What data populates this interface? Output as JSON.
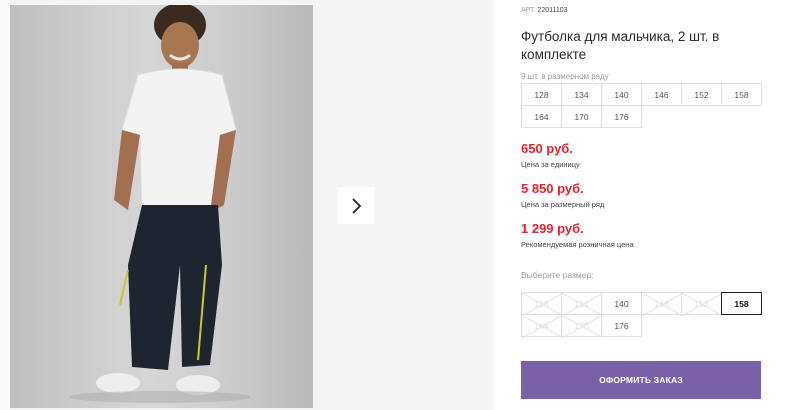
{
  "gallery": {
    "next_icon": "chevron-right-icon"
  },
  "product": {
    "article_prefix": "АРТ.",
    "article_number": "22011103",
    "title": "Футболка для мальчика, 2 шт. в комплекте",
    "row_count": "9 шт. в размерном ряду",
    "size_row": [
      [
        "128",
        "134",
        "140",
        "146",
        "152",
        "158"
      ],
      [
        "164",
        "170",
        "176"
      ]
    ],
    "prices": [
      {
        "value": "650 руб.",
        "label": "Цена за единицу"
      },
      {
        "value": "5 850 руб.",
        "label": "Цена за размерный ряд"
      },
      {
        "value": "1 299 руб.",
        "label": "Рекомендуемая розничная цена"
      }
    ],
    "choose_size_label": "Выберите размер:",
    "size_options": [
      [
        {
          "size": "128",
          "available": false
        },
        {
          "size": "134",
          "available": false
        },
        {
          "size": "140",
          "available": true
        },
        {
          "size": "146",
          "available": false
        },
        {
          "size": "152",
          "available": false
        },
        {
          "size": "158",
          "available": true,
          "selected": true
        }
      ],
      [
        {
          "size": "164",
          "available": false
        },
        {
          "size": "170",
          "available": false
        },
        {
          "size": "176",
          "available": true
        }
      ]
    ],
    "order_button": "ОФОРМИТЬ ЗАКАЗ"
  },
  "colors": {
    "price": "#e2232b",
    "accent_button": "#7b62a8"
  }
}
